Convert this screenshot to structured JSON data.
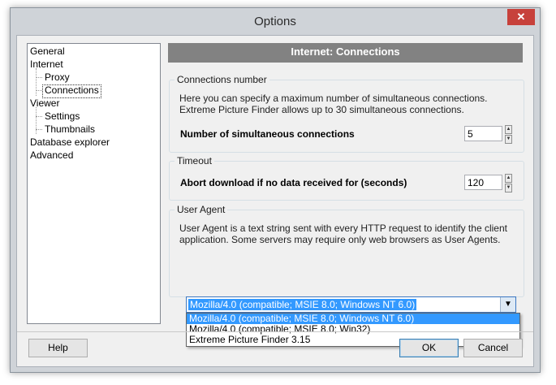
{
  "window": {
    "title": "Options",
    "close_glyph": "✕"
  },
  "tree": {
    "items": [
      {
        "label": "General"
      },
      {
        "label": "Internet"
      },
      {
        "label": "Proxy"
      },
      {
        "label": "Connections"
      },
      {
        "label": "Viewer"
      },
      {
        "label": "Settings"
      },
      {
        "label": "Thumbnails"
      },
      {
        "label": "Database explorer"
      },
      {
        "label": "Advanced"
      }
    ]
  },
  "header": {
    "title": "Internet: Connections"
  },
  "connections": {
    "title": "Connections number",
    "description": "Here you can specify a maximum number of simultaneous connections. Extreme Picture Finder allows up to 30 simultaneous connections.",
    "label": "Number of simultaneous connections",
    "value": "5"
  },
  "timeout": {
    "title": "Timeout",
    "label": "Abort download if no data received for (seconds)",
    "value": "120"
  },
  "user_agent": {
    "title": "User Agent",
    "description": "User Agent is a text string sent with every HTTP request to identify the client application. Some servers may require only web browsers as User Agents.",
    "selected": "Mozilla/4.0 (compatible; MSIE 8.0; Windows NT 6.0)",
    "options": [
      "Mozilla/4.0 (compatible; MSIE 8.0; Windows NT 6.0)",
      "Mozilla/4.0 (compatible; MSIE 8.0; Win32)",
      "Extreme Picture Finder 3.15"
    ]
  },
  "buttons": {
    "help": "Help",
    "ok": "OK",
    "cancel": "Cancel"
  },
  "spin": {
    "up": "▲",
    "down": "▼"
  },
  "combo": {
    "arrow": "▼"
  },
  "colors": {
    "header_bar": "#828282",
    "selection": "#3399ff",
    "close_button": "#c7413b"
  }
}
